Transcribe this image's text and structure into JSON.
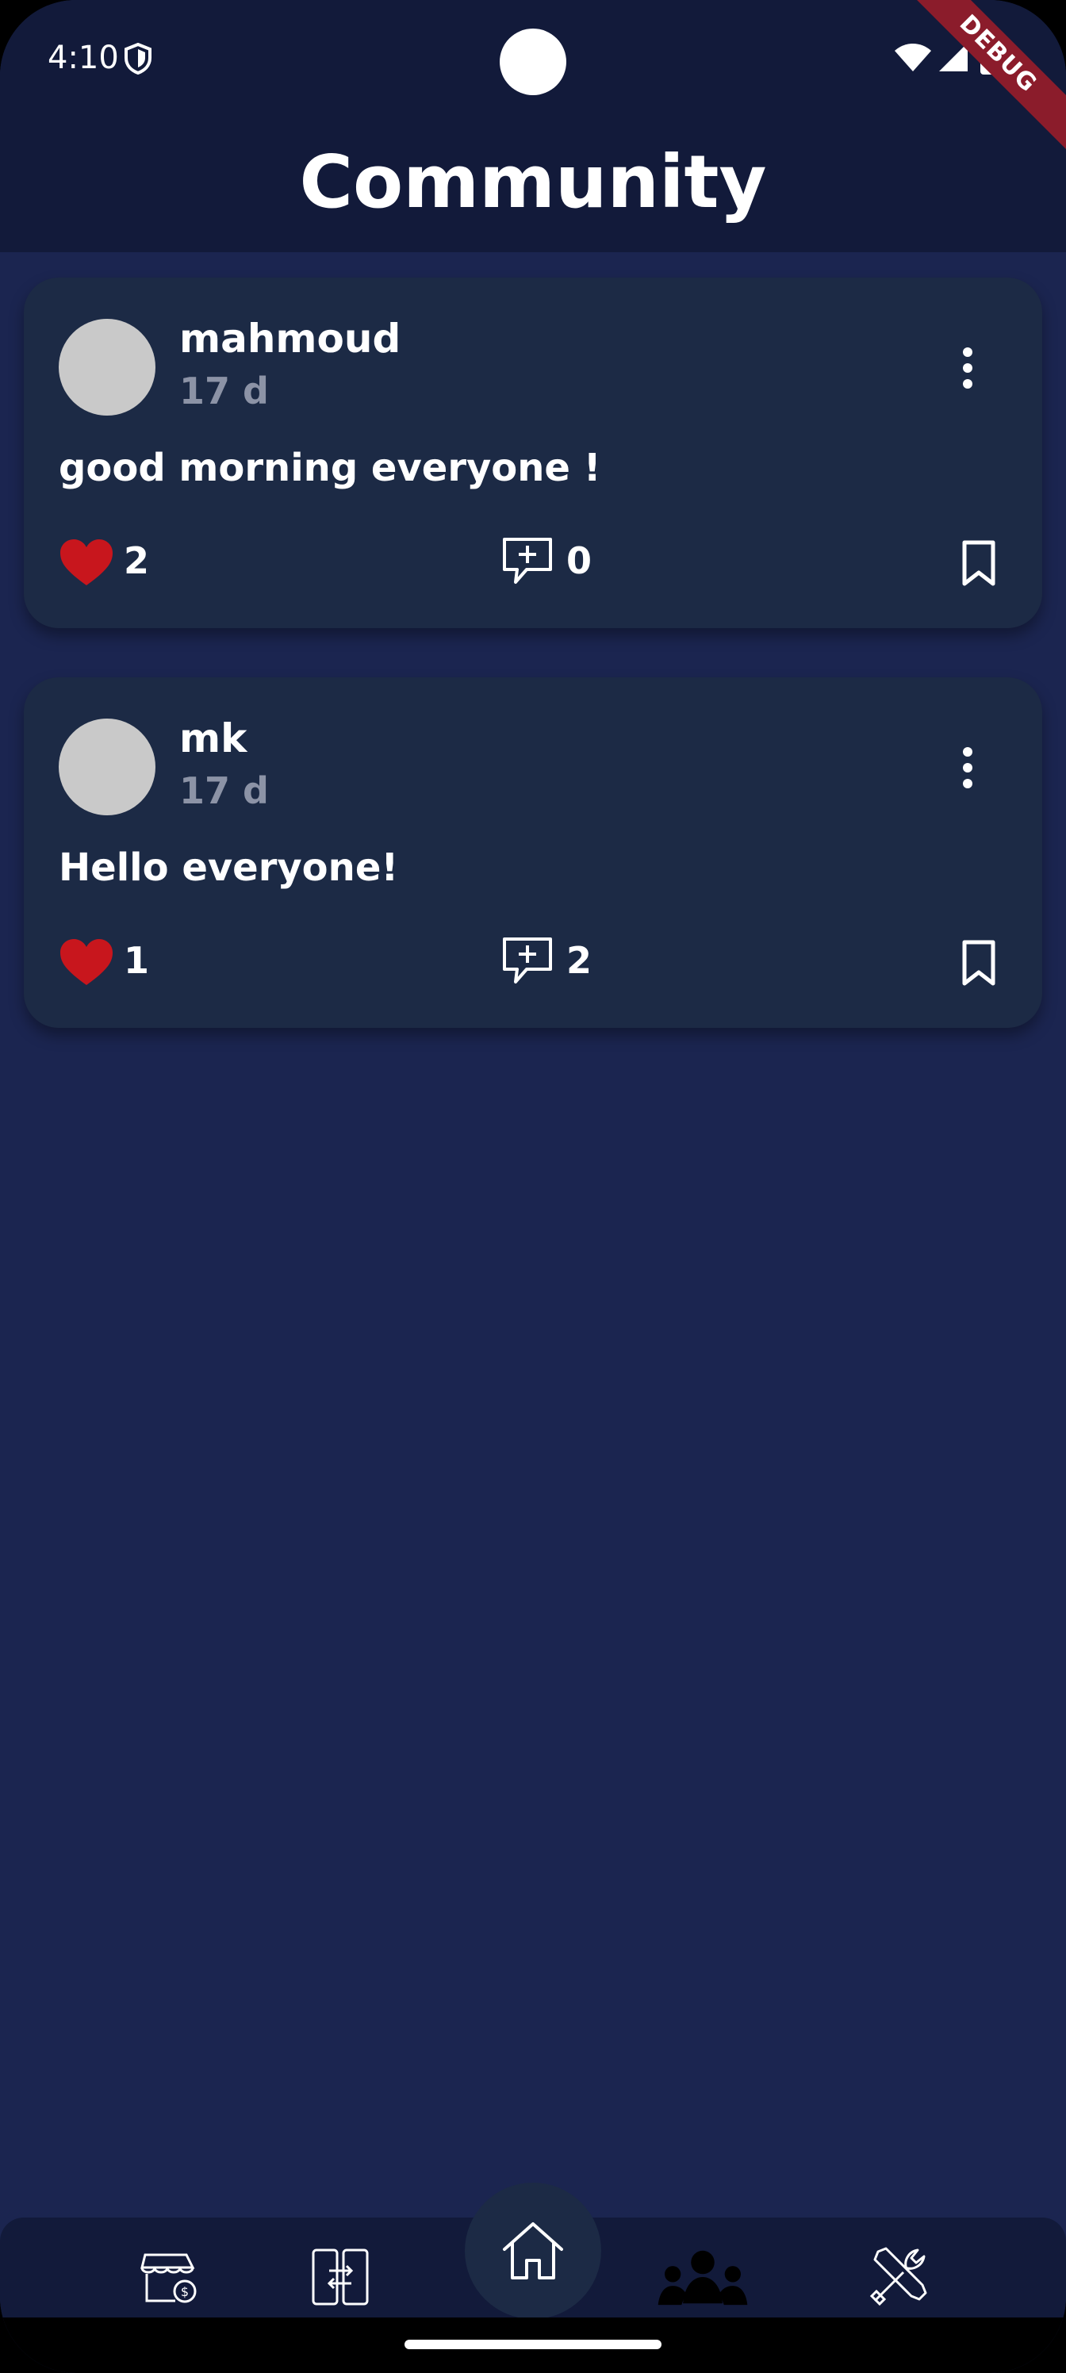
{
  "status_bar": {
    "time": "4:10",
    "debug_label": "DEBUG"
  },
  "header": {
    "title": "Community"
  },
  "posts": [
    {
      "username": "mahmoud",
      "time_ago": "17 d",
      "text": "good morning everyone !",
      "likes": "2",
      "comments": "0"
    },
    {
      "username": "mk",
      "time_ago": "17 d",
      "text": "Hello everyone!",
      "likes": "1",
      "comments": "2"
    }
  ],
  "bottom_nav": {
    "items": [
      "store-icon",
      "transfer-icon",
      "home-icon",
      "community-icon",
      "tools-icon"
    ],
    "active": "community-icon"
  },
  "colors": {
    "background": "#1b2550",
    "header": "#121a3a",
    "card": "#1c2a45",
    "like": "#c8161d",
    "debug_ribbon": "#8b1c2b"
  }
}
